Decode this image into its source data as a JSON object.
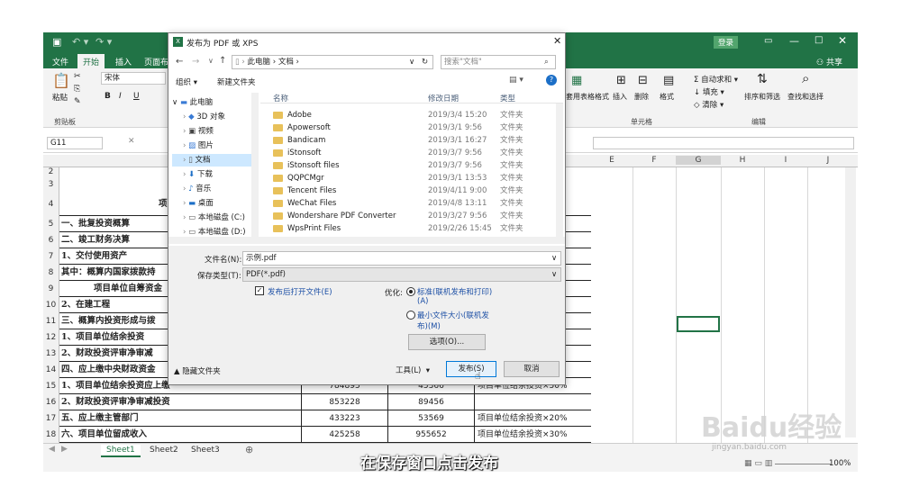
{
  "excel": {
    "login_button": "登录",
    "ribbon_tabs": [
      "文件",
      "开始",
      "插入",
      "页面布"
    ],
    "share": "共享",
    "font_name": "宋体",
    "group_labels": {
      "clipboard": "剪贴板",
      "cells": "单元格",
      "edit": "编辑"
    },
    "paste_label": "粘贴",
    "ribbon_right": {
      "format_table": "套用表格格式",
      "insert": "插入",
      "delete": "删除",
      "format": "格式",
      "autosum": "自动求和",
      "fill": "填充",
      "clear": "清除",
      "sort_filter": "排序和筛选",
      "find_select": "查找和选择"
    },
    "name_box": "G11",
    "columns": [
      "E",
      "F",
      "G",
      "H",
      "I",
      "J"
    ],
    "row_numbers": [
      "2",
      "3",
      "4",
      "5",
      "6",
      "7",
      "8",
      "9",
      "10",
      "11",
      "12",
      "13",
      "14",
      "15",
      "16",
      "17",
      "18"
    ],
    "row_texts": {
      "r4": "项",
      "r5": "一、批复投资概算",
      "r6": "二、竣工财务决算",
      "r7": "1、交付使用资产",
      "r8": "其中：概算内国家拨款持",
      "r9": "项目单位自筹资金",
      "r10": "2、在建工程",
      "r11": "三、概算内投资形成与拨",
      "r12": "1、项目单位结余投资",
      "r13": "2、财政投资评审净审减",
      "r14": "四、应上缴中央财政资金"
    },
    "table_rows": [
      {
        "num": "15",
        "label": "1、项目单位结余投资应上缴",
        "v1": "784895",
        "v2": "45366",
        "note": "项目单位结余投资×50%"
      },
      {
        "num": "16",
        "label": "2、财政投资评审净审减投资",
        "v1": "853228",
        "v2": "89456",
        "note": ""
      },
      {
        "num": "17",
        "label": "五、应上缴主管部门",
        "v1": "433223",
        "v2": "53569",
        "note": "项目单位结余投资×20%"
      },
      {
        "num": "18",
        "label": "六、项目单位留成收入",
        "v1": "425258",
        "v2": "955652",
        "note": "项目单位结余投资×30%"
      }
    ],
    "sheets": [
      "Sheet1",
      "Sheet2",
      "Sheet3"
    ],
    "zoom": "100%"
  },
  "dialog": {
    "title": "发布为 PDF 或 XPS",
    "path": [
      "此电脑",
      "文档"
    ],
    "search_placeholder": "搜索\"文档\"",
    "organize": "组织 ▾",
    "new_folder": "新建文件夹",
    "col_name": "名称",
    "col_date": "修改日期",
    "col_type": "类型",
    "nav_items": [
      "此电脑",
      "3D 对象",
      "视频",
      "图片",
      "文档",
      "下载",
      "音乐",
      "桌面",
      "本地磁盘 (C:)",
      "本地磁盘 (D:)"
    ],
    "files": [
      {
        "name": "Adobe",
        "date": "2019/3/4 15:20",
        "type": "文件夹"
      },
      {
        "name": "Apowersoft",
        "date": "2019/3/1 9:56",
        "type": "文件夹"
      },
      {
        "name": "Bandicam",
        "date": "2019/3/1 16:27",
        "type": "文件夹"
      },
      {
        "name": "iStonsoft",
        "date": "2019/3/7 9:56",
        "type": "文件夹"
      },
      {
        "name": "iStonsoft files",
        "date": "2019/3/7 9:56",
        "type": "文件夹"
      },
      {
        "name": "QQPCMgr",
        "date": "2019/3/1 13:53",
        "type": "文件夹"
      },
      {
        "name": "Tencent Files",
        "date": "2019/4/11 9:00",
        "type": "文件夹"
      },
      {
        "name": "WeChat Files",
        "date": "2019/4/8 13:11",
        "type": "文件夹"
      },
      {
        "name": "Wondershare PDF Converter",
        "date": "2019/3/27 9:56",
        "type": "文件夹"
      },
      {
        "name": "WpsPrint Files",
        "date": "2019/2/26 15:45",
        "type": "文件夹"
      }
    ],
    "filename_label": "文件名(N):",
    "filename_value": "示例.pdf",
    "savetype_label": "保存类型(T):",
    "savetype_value": "PDF(*.pdf)",
    "open_after": "发布后打开文件(E)",
    "optimize_label": "优化:",
    "opt_standard": "标准(联机发布和打印)",
    "opt_standard_key": "(A)",
    "opt_min": "最小文件大小(联机发",
    "opt_min2": "布)(M)",
    "options_btn": "选项(O)...",
    "hide_folders": "隐藏文件夹",
    "tools": "工具(L)",
    "publish": "发布(S)",
    "cancel": "取消"
  },
  "subtitle": "在保存窗口点击发布",
  "watermark": {
    "text": "Baidu经验",
    "url": "jingyan.baidu.com"
  }
}
